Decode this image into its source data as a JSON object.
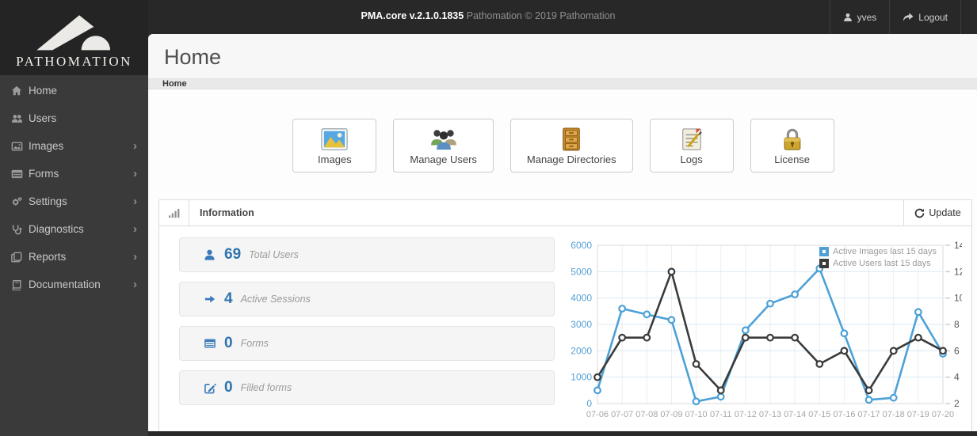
{
  "topbar": {
    "title_strong": "PMA.core v.2.1.0.1835",
    "title_rest": "Pathomation © 2019 Pathomation",
    "user": "yves",
    "logout_label": "Logout"
  },
  "brand": {
    "name": "PATHOMATION"
  },
  "sidebar": {
    "items": [
      {
        "label": "Home",
        "icon": "home-icon",
        "has_submenu": false
      },
      {
        "label": "Users",
        "icon": "users-icon",
        "has_submenu": false
      },
      {
        "label": "Images",
        "icon": "images-icon",
        "has_submenu": true
      },
      {
        "label": "Forms",
        "icon": "forms-icon",
        "has_submenu": true
      },
      {
        "label": "Settings",
        "icon": "settings-icon",
        "has_submenu": true
      },
      {
        "label": "Diagnostics",
        "icon": "diagnostics-icon",
        "has_submenu": true
      },
      {
        "label": "Reports",
        "icon": "reports-icon",
        "has_submenu": true
      },
      {
        "label": "Documentation",
        "icon": "documentation-icon",
        "has_submenu": true
      }
    ],
    "chevron": "›"
  },
  "page": {
    "title": "Home",
    "breadcrumb": "Home"
  },
  "quick_actions": [
    {
      "label": "Images",
      "icon": "images-picture-icon"
    },
    {
      "label": "Manage Users",
      "icon": "manage-users-icon"
    },
    {
      "label": "Manage Directories",
      "icon": "manage-directories-icon"
    },
    {
      "label": "Logs",
      "icon": "logs-icon"
    },
    {
      "label": "License",
      "icon": "license-lock-icon"
    }
  ],
  "panel": {
    "title": "Information",
    "update_label": "Update"
  },
  "stats": [
    {
      "value": "69",
      "label": "Total Users",
      "icon": "user-icon"
    },
    {
      "value": "4",
      "label": "Active Sessions",
      "icon": "arrow-right-icon"
    },
    {
      "value": "0",
      "label": "Forms",
      "icon": "form-table-icon"
    },
    {
      "value": "0",
      "label": "Filled forms",
      "icon": "edit-pencil-icon"
    }
  ],
  "colors": {
    "accent_blue": "#2e73ae",
    "chart_blue": "#4da1d6",
    "chart_black": "#3b3b3b",
    "grid_blue": "#dbe9f3",
    "grid_gray": "#e9eef1"
  },
  "chart_data": {
    "type": "line",
    "categories": [
      "07-06",
      "07-07",
      "07-08",
      "07-09",
      "07-10",
      "07-11",
      "07-12",
      "07-13",
      "07-14",
      "07-15",
      "07-16",
      "07-17",
      "07-18",
      "07-19",
      "07-20"
    ],
    "series": [
      {
        "name": "Active Images last 15 days",
        "axis": "left",
        "color": "#4da1d6",
        "values": [
          500,
          3600,
          3380,
          3170,
          80,
          260,
          2780,
          3790,
          4140,
          5120,
          2660,
          140,
          220,
          3470,
          1890
        ]
      },
      {
        "name": "Active Users last 15 days",
        "axis": "right",
        "color": "#3b3b3b",
        "values": [
          4,
          7,
          7,
          12,
          5,
          3,
          7,
          7,
          7,
          5,
          6,
          3,
          6,
          7,
          6
        ]
      }
    ],
    "left_axis": {
      "min": 0,
      "max": 6000,
      "step": 1000
    },
    "right_axis": {
      "min": 2,
      "max": 14,
      "step": 2
    },
    "grid": true,
    "legend_position": "top-right"
  }
}
